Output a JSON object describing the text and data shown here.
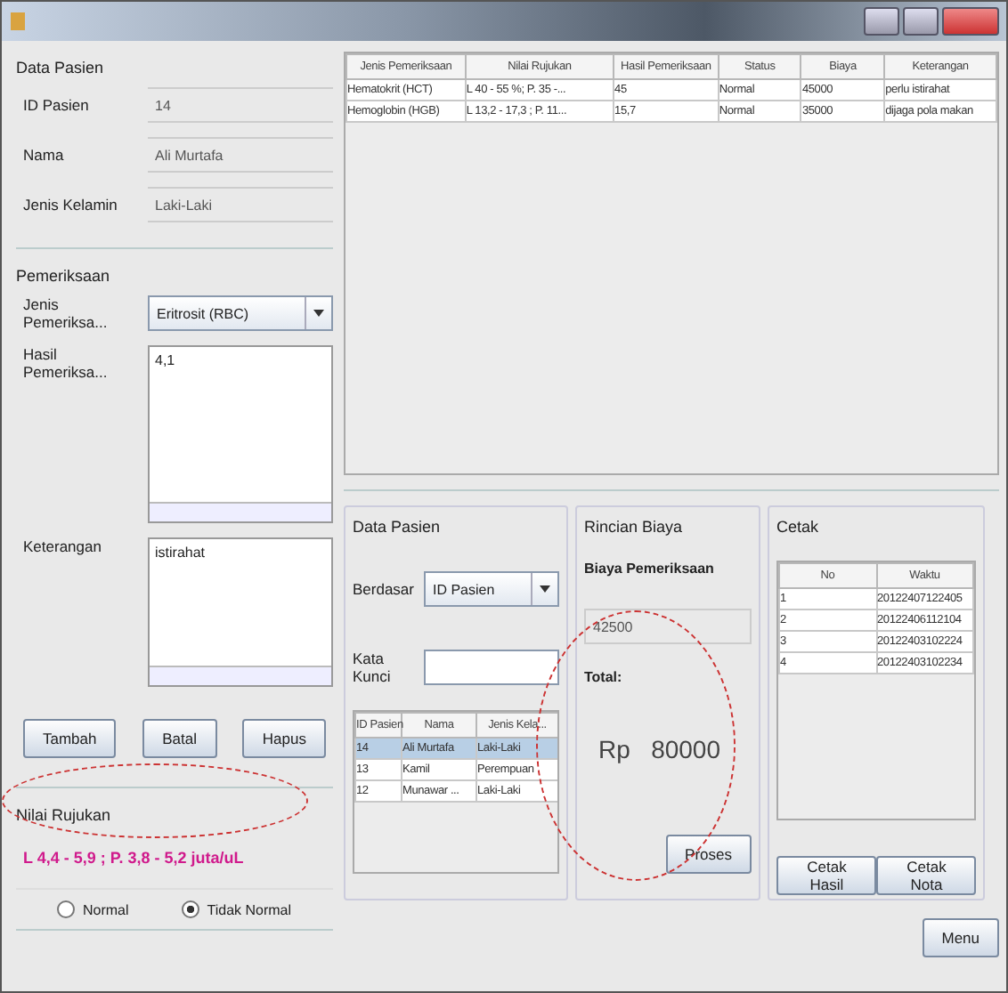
{
  "patient": {
    "title": "Data Pasien",
    "fields": [
      {
        "label": "ID Pasien",
        "value": "14"
      },
      {
        "label": "Nama",
        "value": "Ali Murtafa"
      },
      {
        "label": "Jenis Kelamin",
        "value": "Laki-Laki"
      }
    ]
  },
  "exam": {
    "title": "Pemeriksaan",
    "type_label": "Jenis Pemeriksa...",
    "type_value": "Eritrosit (RBC)",
    "result_label": "Hasil Pemeriksa...",
    "result_value": "4,1",
    "note_label": "Keterangan",
    "note_value": "istirahat"
  },
  "buttons": [
    "Tambah",
    "Batal",
    "Hapus"
  ],
  "reference": {
    "title": "Nilai Rujukan",
    "value": "L 4,4 - 5,9 ; P. 3,8 - 5,2 juta/uL",
    "options": [
      {
        "label": "Normal",
        "selected": false
      },
      {
        "label": "Tidak Normal",
        "selected": true
      }
    ]
  },
  "results": {
    "columns": [
      "Jenis Pemeriksaan",
      "Nilai Rujukan",
      "Hasil Pemeriksaan",
      "Status",
      "Biaya",
      "Keterangan"
    ],
    "rows": [
      [
        "Hematokrit (HCT)",
        "L 40 - 55 %; P. 35 -...",
        "45",
        "Normal",
        "45000",
        "perlu istirahat"
      ],
      [
        "Hemoglobin (HGB)",
        "L 13,2 - 17,3 ; P. 11...",
        "15,7",
        "Normal",
        "35000",
        "dijaga pola makan"
      ]
    ]
  },
  "search": {
    "title": "Data Pasien",
    "by_label": "Berdasar",
    "by_value": "ID Pasien",
    "keyword_label": "Kata Kunci",
    "columns": [
      "ID Pasien",
      "Nama",
      "Jenis Kela..."
    ],
    "rows": [
      {
        "cells": [
          "14",
          "Ali Murtafa",
          "Laki-Laki"
        ],
        "selected": true
      },
      {
        "cells": [
          "13",
          "Kamil",
          "Perempuan"
        ],
        "selected": false
      },
      {
        "cells": [
          "12",
          "Munawar ...",
          "Laki-Laki"
        ],
        "selected": false
      }
    ]
  },
  "cost": {
    "title": "Rincian Biaya",
    "label": "Biaya Pemeriksaan",
    "value": "42500",
    "total_label": "Total:",
    "total": "Rp   80000",
    "button": "Proses"
  },
  "print": {
    "title": "Cetak",
    "columns": [
      "No",
      "Waktu"
    ],
    "rows": [
      [
        "1",
        "20122407122405"
      ],
      [
        "2",
        "20122406112104"
      ],
      [
        "3",
        "20122403102224"
      ],
      [
        "4",
        "20122403102234"
      ]
    ],
    "buttons": [
      "Cetak Hasil",
      "Cetak Nota"
    ]
  },
  "menu_button": "Menu"
}
